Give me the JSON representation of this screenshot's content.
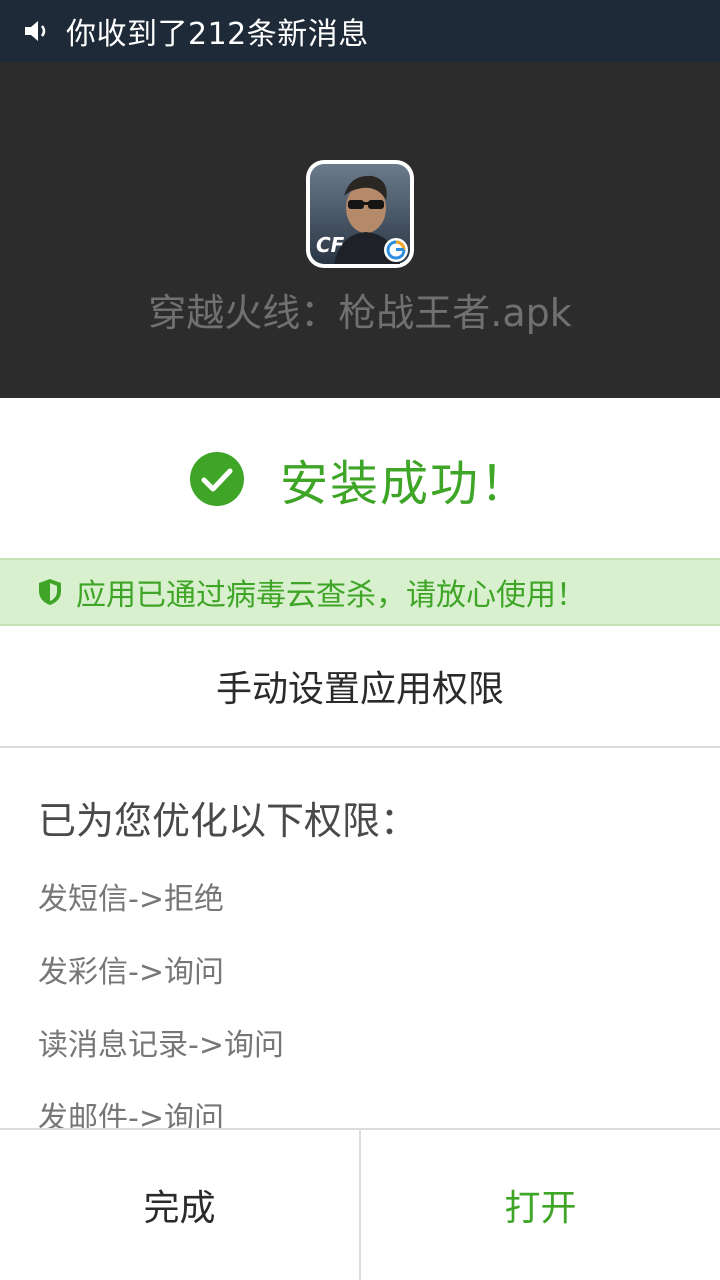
{
  "status_bar": {
    "icon": "speaker-icon",
    "message": "你收到了212条新消息"
  },
  "app": {
    "icon": "game-app-icon",
    "name": "穿越火线：枪战王者.apk"
  },
  "result": {
    "icon": "check-circle-icon",
    "text": "安装成功！",
    "color": "#3fa527"
  },
  "scan": {
    "icon": "shield-icon",
    "text": "应用已通过病毒云查杀，请放心使用！",
    "background": "#d9f0cf"
  },
  "manual": {
    "label": "手动设置应用权限"
  },
  "permissions": {
    "title": "已为您优化以下权限：",
    "items": [
      "发短信->拒绝",
      "发彩信->询问",
      "读消息记录->询问",
      "发邮件->询问"
    ]
  },
  "buttons": {
    "done": "完成",
    "open": "打开"
  }
}
